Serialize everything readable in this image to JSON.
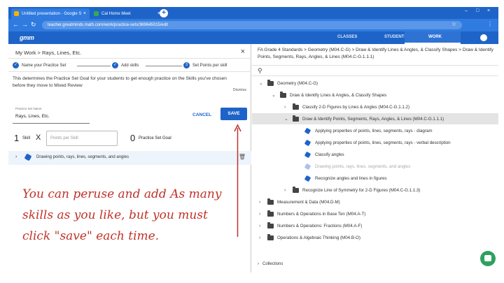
{
  "browser": {
    "tabs": [
      {
        "title": "Untitled presentation - Google S",
        "close": "×"
      },
      {
        "title": "Cal Home Meet",
        "close": "×"
      }
    ],
    "new_tab": "+",
    "window_controls": [
      "–",
      "□",
      "×"
    ],
    "back": "←",
    "forward": "→",
    "reload": "↻",
    "url": "teacher.greatminds.math.com/work/practice-sets/369645015/edit",
    "star": "☆",
    "menu": "⋮"
  },
  "app": {
    "logo": "gmm",
    "nav": {
      "classes": "CLASSES",
      "students": "STUDENTS",
      "work": "WORK"
    }
  },
  "left": {
    "breadcrumb": "My Work  >  Rays, Lines, Etc.",
    "close": "×",
    "steps": [
      {
        "label": "Name your Practice Set",
        "mark": "✓"
      },
      {
        "label": "Add skills",
        "mark": "✓"
      },
      {
        "label": "Set Points per skill",
        "mark": "3"
      }
    ],
    "description": "This determines the Practice Set Goal for your students to get enough practice on the Skills you've chosen before they move to Mixed Review",
    "dismiss": "Dismiss",
    "practice_set_name_label": "Practice Set Name",
    "practice_set_name_value": "Rays, Lines, Etc.",
    "cancel": "CANCEL",
    "save": "SAVE",
    "skill_count": "1",
    "skill_label": "Skill",
    "times": "X",
    "points_placeholder": "Points per Skill",
    "goal_value": "0",
    "goal_label": "Practice Set Goal",
    "skill_item": "Drawing points, rays, lines, segments, and angles",
    "annotation": "You can peruse and add As many skills as you like, but you must click \"save\" each time."
  },
  "right": {
    "breadcrumb": "FA Grade 4 Standards  >  Geometry (M04.C-G)  >  Draw & Identify Lines & Angles, & Classify Shapes  >  Draw & Identify Points, Segments, Rays, Angles, & Lines (M04.C-G.1.1.1)",
    "search_icon": "⚲",
    "tree": [
      {
        "label": "Geometry (M04.C-G)",
        "type": "folder",
        "chev": "⌄",
        "indent": 0
      },
      {
        "label": "Draw & Identify Lines & Angles, & Classify Shapes",
        "type": "folder",
        "chev": "⌄",
        "indent": 1
      },
      {
        "label": "Classify 2-D Figures by Lines & Angles (M04.C-G.1.1.2)",
        "type": "folder",
        "chev": "›",
        "indent": 2
      },
      {
        "label": "Draw & Identify Points, Segments, Rays, Angles, & Lines (M04.C-G.1.1.1)",
        "type": "folder",
        "chev": "⌄",
        "indent": 2,
        "selected": true
      },
      {
        "label": "Applying properties of points, lines, segments, rays - diagram",
        "type": "skill",
        "indent": 3
      },
      {
        "label": "Applying properties of points, lines, segments, rays - verbal description",
        "type": "skill",
        "indent": 3
      },
      {
        "label": "Classify angles",
        "type": "skill",
        "indent": 3
      },
      {
        "label": "Drawing points, rays, lines, segments, and angles",
        "type": "skill",
        "indent": 3,
        "faded": true
      },
      {
        "label": "Recognize angles and lines in figures",
        "type": "skill",
        "indent": 3
      },
      {
        "label": "Recognize Line of Symmetry for 2-D Figures (M04.C-G.1.1.3)",
        "type": "folder",
        "chev": "›",
        "indent": 2
      },
      {
        "label": "Measurement & Data (M04.D-M)",
        "type": "folder",
        "chev": "›",
        "indent": 0
      },
      {
        "label": "Numbers & Operations in Base Ten (M04.A-T)",
        "type": "folder",
        "chev": "›",
        "indent": 0
      },
      {
        "label": "Numbers & Operations: Fractions (M04.A-F)",
        "type": "folder",
        "chev": "›",
        "indent": 0
      },
      {
        "label": "Operations & Algebraic Thinking (M04.B-O)",
        "type": "folder",
        "chev": "›",
        "indent": 0
      }
    ],
    "collections": "Collections"
  },
  "colors": {
    "brand": "#1e64c8",
    "annotation": "#c0322a",
    "chat": "#2da160"
  }
}
